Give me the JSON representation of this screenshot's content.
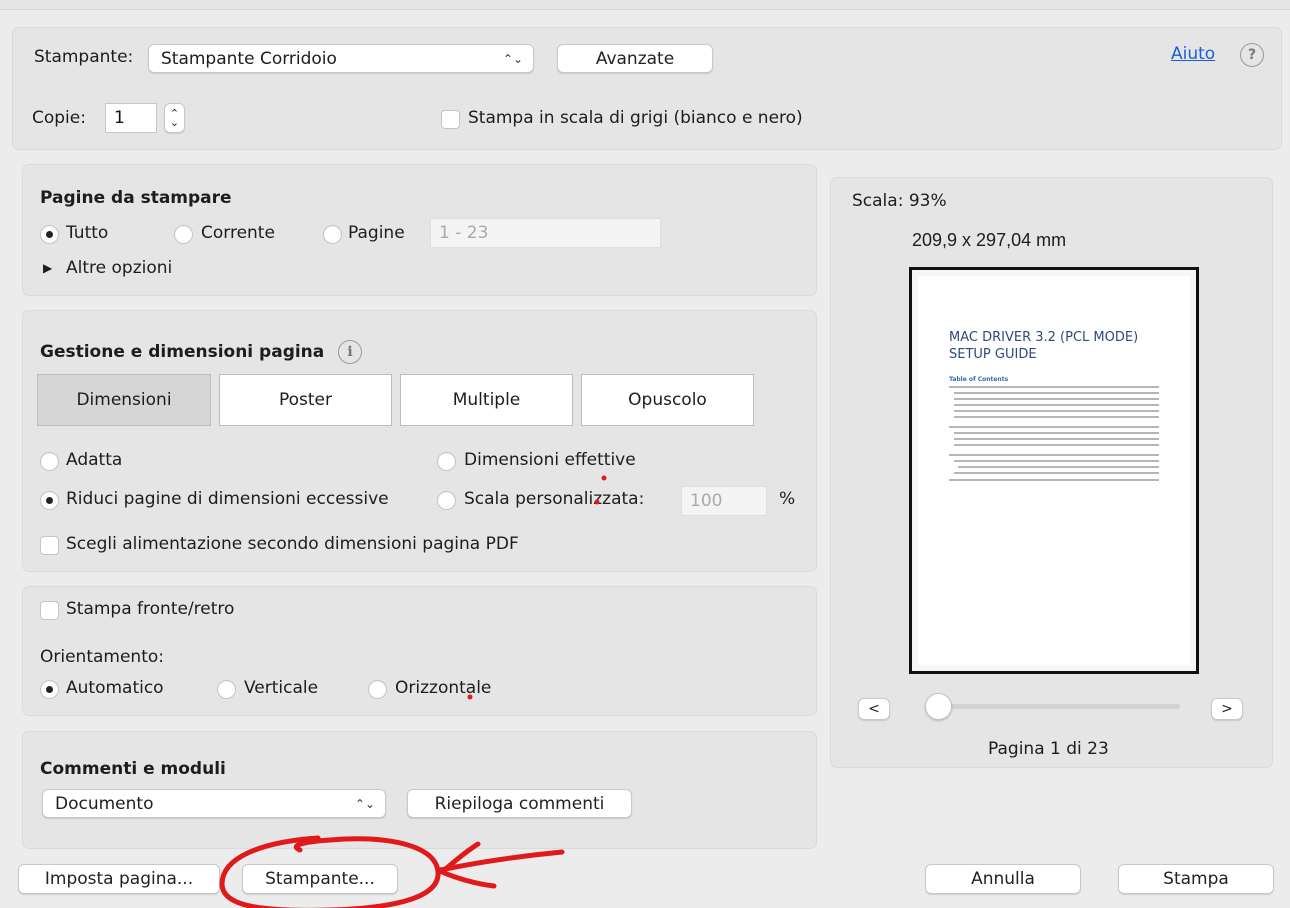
{
  "printer": {
    "label": "Stampante:",
    "value": "Stampante Corridoio",
    "advanced_button": "Avanzate",
    "help_link": "Aiuto",
    "help_icon": "?"
  },
  "copies": {
    "label": "Copie:",
    "value": "1",
    "grayscale_label": "Stampa in scala di grigi (bianco e nero)"
  },
  "pages": {
    "title": "Pagine da stampare",
    "all": "Tutto",
    "current": "Corrente",
    "pages": "Pagine",
    "range_placeholder": "1 - 23",
    "more_options": "Altre opzioni",
    "selected": "Tutto"
  },
  "page_handling": {
    "title": "Gestione e dimensioni pagina",
    "info_icon": "i",
    "tabs": [
      "Dimensioni",
      "Poster",
      "Multiple",
      "Opuscolo"
    ],
    "selected_tab": "Dimensioni",
    "fit": "Adatta",
    "actual_size": "Dimensioni effettive",
    "shrink": "Riduci pagine di dimensioni eccessive",
    "custom_scale": "Scala personalizzata:",
    "custom_scale_value": "100",
    "percent": "%",
    "paper_source": "Scegli alimentazione secondo dimensioni pagina PDF",
    "selected_option": "Riduci pagine di dimensioni eccessive"
  },
  "duplex": {
    "label": "Stampa fronte/retro",
    "orientation_label": "Orientamento:",
    "auto": "Automatico",
    "portrait": "Verticale",
    "landscape": "Orizzontale",
    "selected": "Automatico"
  },
  "comments": {
    "title": "Commenti e moduli",
    "value": "Documento",
    "summarize_button": "Riepiloga commenti"
  },
  "preview": {
    "scale": "Scala:  93%",
    "size": "209,9 x 297,04 mm",
    "doc_title_line1": "MAC DRIVER 3.2 (PCL MODE)",
    "doc_title_line2": "SETUP GUIDE",
    "toc_heading": "Table of Contents",
    "prev": "<",
    "next": ">",
    "page_status": "Pagina 1 di 23",
    "slider_position": 0
  },
  "footer": {
    "page_setup": "Imposta pagina...",
    "printer": "Stampante...",
    "cancel": "Annulla",
    "print": "Stampa"
  },
  "colors": {
    "accent_link": "#1a5fd6",
    "annotation": "#e0191b"
  },
  "icons": [
    "stepper-icon",
    "help-icon",
    "info-icon",
    "disclosure-triangle-icon",
    "popup-chevron-icon"
  ]
}
